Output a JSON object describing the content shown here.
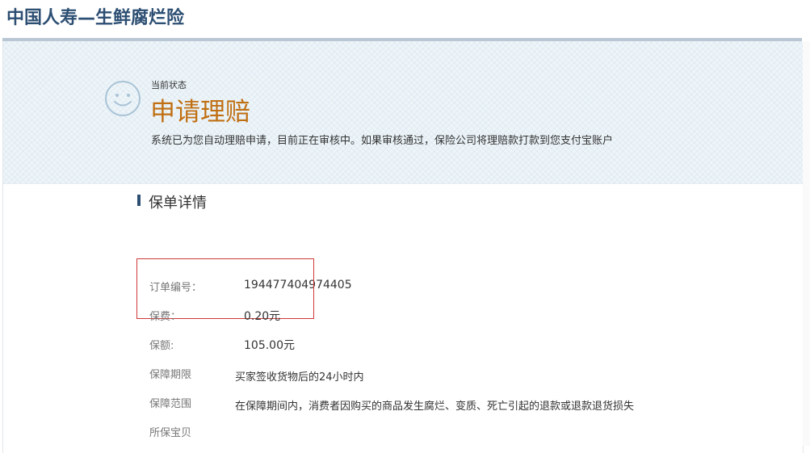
{
  "header": {
    "title": "中国人寿—生鲜腐烂险"
  },
  "status": {
    "label": "当前状态",
    "title": "申请理赔",
    "description": "系统已为您自动理赔申请，目前正在审核中。如果审核通过，保险公司将理赔款打款到您支付宝账户",
    "icon": "smiley-face-icon"
  },
  "section": {
    "title": "保单详情"
  },
  "details": [
    {
      "label": "订单编号：",
      "value": "194477404974405"
    },
    {
      "label": "保费：",
      "value": "0.20元"
    },
    {
      "label": "保额:",
      "value": "105.00元"
    },
    {
      "label": "保障期限",
      "value": "买家签收货物后的24小时内"
    },
    {
      "label": "保障范围",
      "value": "在保障期间内，消费者因购买的商品发生腐烂、变质、死亡引起的退款或退款退货损失"
    },
    {
      "label": "所保宝贝",
      "value": ""
    }
  ],
  "colors": {
    "title": "#2d4f73",
    "status_title": "#c06f12",
    "highlight_border": "#d0393a"
  }
}
